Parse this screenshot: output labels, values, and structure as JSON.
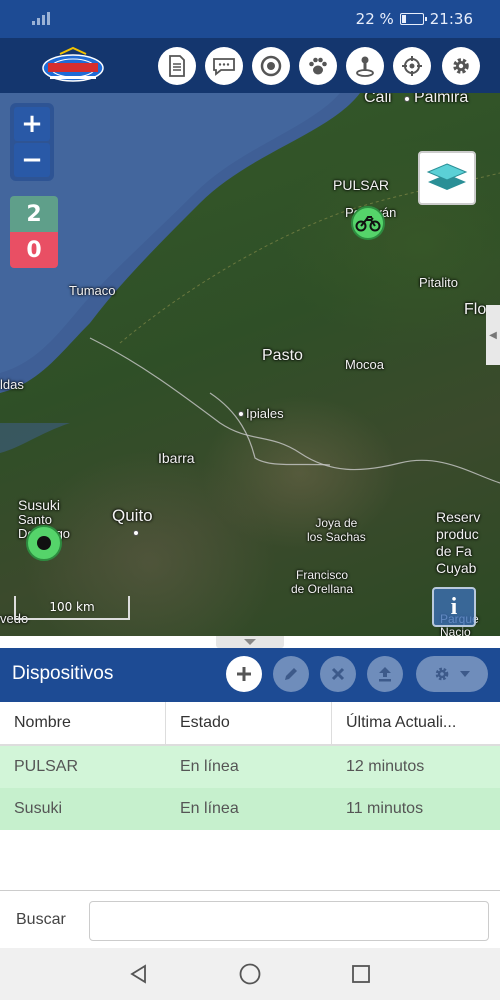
{
  "status_bar": {
    "battery_text": "22 %",
    "battery_level": 0.22,
    "time": "21:36"
  },
  "toolbar": {
    "icons": [
      "report-icon",
      "chat-icon",
      "target-icon",
      "paw-icon",
      "geofence-icon",
      "locate-icon",
      "gear-icon"
    ]
  },
  "map": {
    "zoom_in": "+",
    "zoom_out": "−",
    "online_count": "2",
    "offline_count": "0",
    "scale_label": "100 km",
    "info_label": "i",
    "labels": {
      "cali": "Cali",
      "palmira": "Palmira",
      "pulsar": "PULSAR",
      "popayan": "Popayán",
      "tumaco": "Tumaco",
      "pitalito": "Pitalito",
      "flo": "Flo",
      "pasto": "Pasto",
      "mocoa": "Mocoa",
      "ipiales": "Ipiales",
      "ldas": "ldas",
      "ibarra": "Ibarra",
      "susuki": "Susuki",
      "santo_domingo": "Santo\nDomingo",
      "quito": "Quito",
      "joya": "Joya de\nlos Sachas",
      "reserv": "Reserv\nproduc\nde Fa\nCuyab",
      "francisco": "Francisco\nde Orellana",
      "vedo": "vedo",
      "parque": "Parque\nNacio"
    }
  },
  "panel": {
    "title": "Dispositivos"
  },
  "table": {
    "headers": [
      "Nombre",
      "Estado",
      "Última Actuali..."
    ],
    "rows": [
      {
        "name": "PULSAR",
        "status": "En línea",
        "updated": "12 minutos"
      },
      {
        "name": "Susuki",
        "status": "En línea",
        "updated": "11 minutos"
      }
    ]
  },
  "search": {
    "label": "Buscar",
    "value": ""
  },
  "colors": {
    "statusbar": "#1d4b94",
    "appbar": "#14366e",
    "row_highlight": "#d2f5d8",
    "online": "#5f9f8a",
    "offline": "#e94f64",
    "marker": "#55d46a"
  }
}
